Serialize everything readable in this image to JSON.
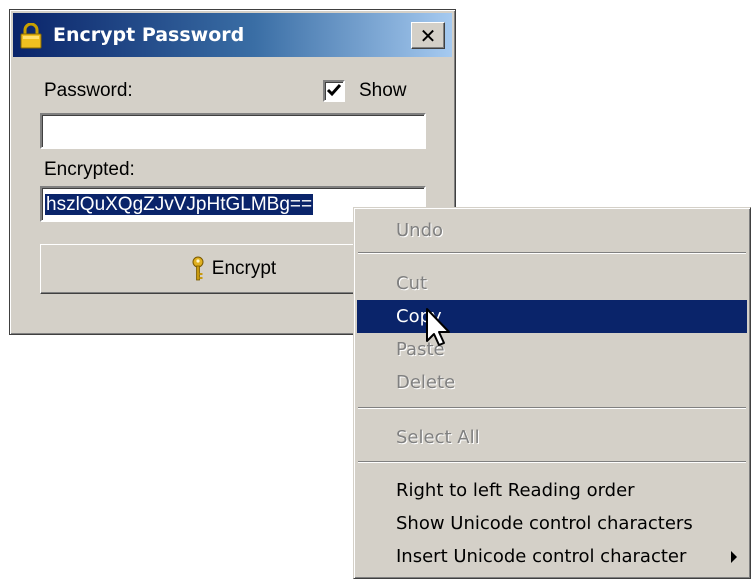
{
  "window": {
    "title": "Encrypt Password",
    "close_label": "✕"
  },
  "form": {
    "password_label": "Password:",
    "show_label": "Show",
    "show_checked": true,
    "password_value": "",
    "encrypted_label": "Encrypted:",
    "encrypted_value": "hszlQuXQgZJvVJpHtGLMBg==",
    "encrypt_button_label": "Encrypt"
  },
  "context_menu": {
    "items": [
      {
        "label": "Undo",
        "enabled": false
      },
      {
        "label": "Cut",
        "enabled": false
      },
      {
        "label": "Copy",
        "enabled": true,
        "highlighted": true
      },
      {
        "label": "Paste",
        "enabled": false
      },
      {
        "label": "Delete",
        "enabled": false
      },
      {
        "label": "Select All",
        "enabled": false
      },
      {
        "label": "Right to left Reading order",
        "enabled": true
      },
      {
        "label": "Show Unicode control characters",
        "enabled": true
      },
      {
        "label": "Insert Unicode control character",
        "enabled": true,
        "submenu": true
      }
    ]
  },
  "colors": {
    "title_gradient_start": "#0a246a",
    "title_gradient_end": "#a6caf0",
    "selection": "#0a246a",
    "face": "#d4d0c8"
  }
}
